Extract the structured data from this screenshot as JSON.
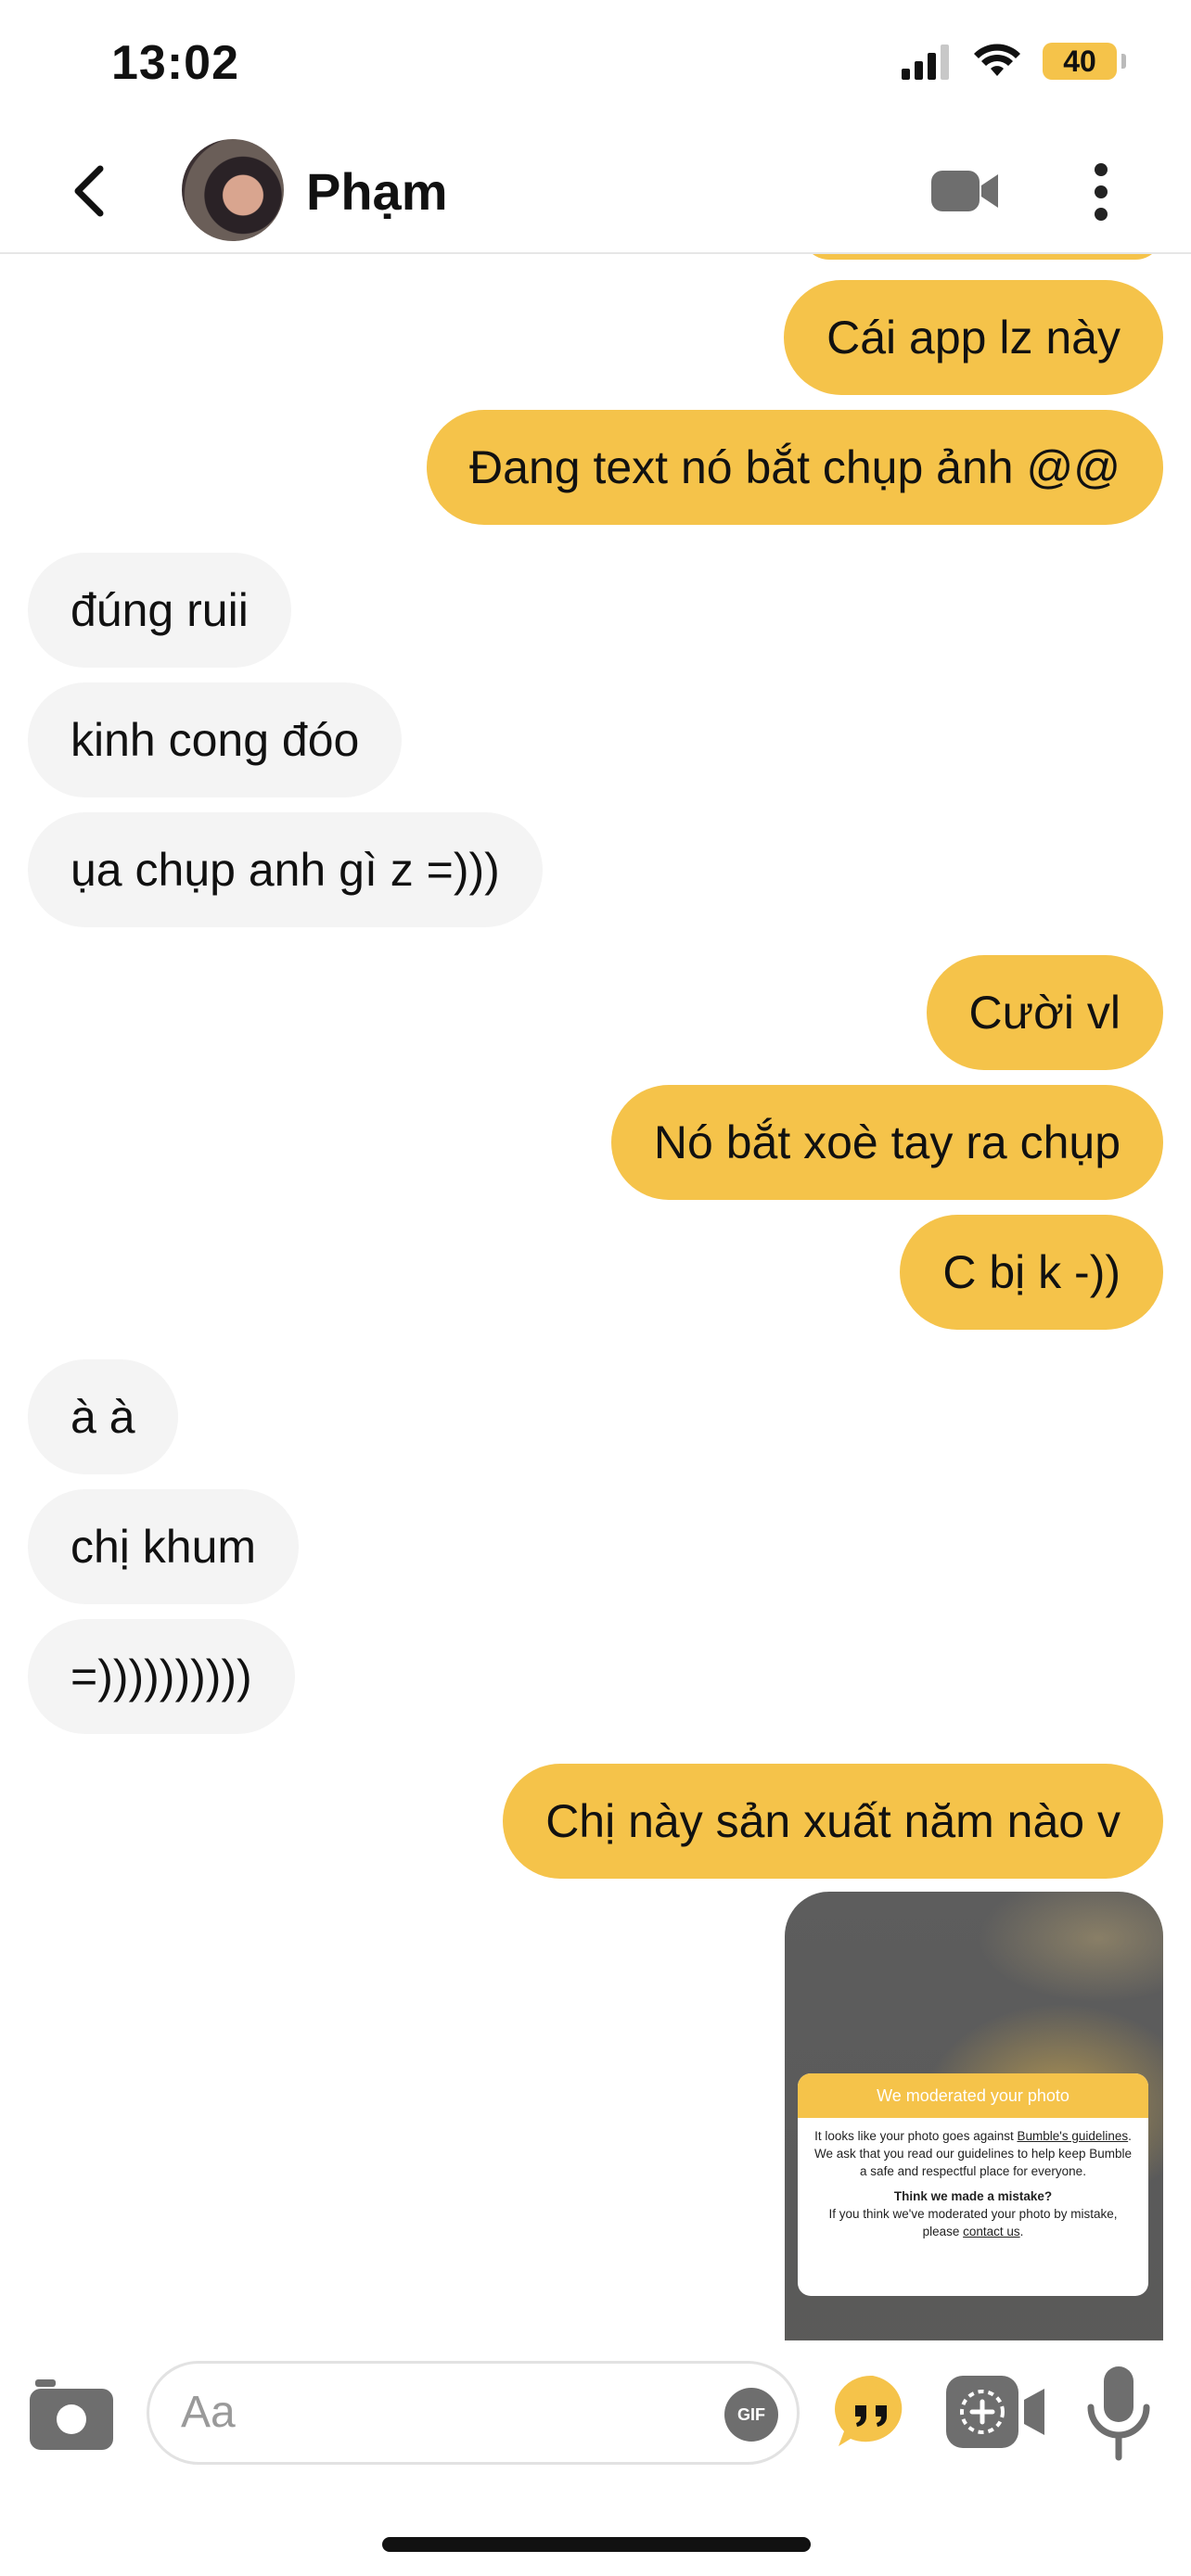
{
  "status_bar": {
    "time": "13:02",
    "battery": "40"
  },
  "header": {
    "contact_name": "Phạm"
  },
  "messages": [
    {
      "direction": "out",
      "text": "Cái app lz này"
    },
    {
      "direction": "out",
      "text": "Đang text nó bắt chụp ảnh @@"
    },
    {
      "direction": "in",
      "text": "đúng ruii"
    },
    {
      "direction": "in",
      "text": "kinh cong đóo"
    },
    {
      "direction": "in",
      "text": "ụa chụp anh gì z =)))"
    },
    {
      "direction": "out",
      "text": "Cười vl"
    },
    {
      "direction": "out",
      "text": "Nó bắt xoè tay ra chụp"
    },
    {
      "direction": "out",
      "text": "C bị k -))"
    },
    {
      "direction": "in",
      "text": "à à"
    },
    {
      "direction": "in",
      "text": "chị khum"
    },
    {
      "direction": "in",
      "text": "=))))))))))"
    },
    {
      "direction": "out",
      "text": "Chị này sản xuất năm nào v"
    }
  ],
  "moderation_card": {
    "title": "We moderated your photo",
    "line1_a": "It looks like your photo goes against ",
    "line1_link": "Bumble's guidelines",
    "line1_b": ".",
    "line2": "We ask that you read our guidelines to help keep Bumble a safe and respectful place for everyone.",
    "heading2": "Think we made a mistake?",
    "line3_a": "If you think we've moderated your photo by mistake, please ",
    "line3_link": "contact us",
    "line3_b": "."
  },
  "composer": {
    "placeholder": "Aa",
    "gif_label": "GIF"
  },
  "colors": {
    "accent": "#f5c34a",
    "incoming_bubble": "#f4f4f4",
    "icon_gray": "#6e6e6e"
  },
  "icons": [
    "back-chevron-icon",
    "video-call-icon",
    "more-vertical-icon",
    "camera-icon",
    "gif-icon",
    "quote-icon",
    "video-message-icon",
    "microphone-icon"
  ]
}
